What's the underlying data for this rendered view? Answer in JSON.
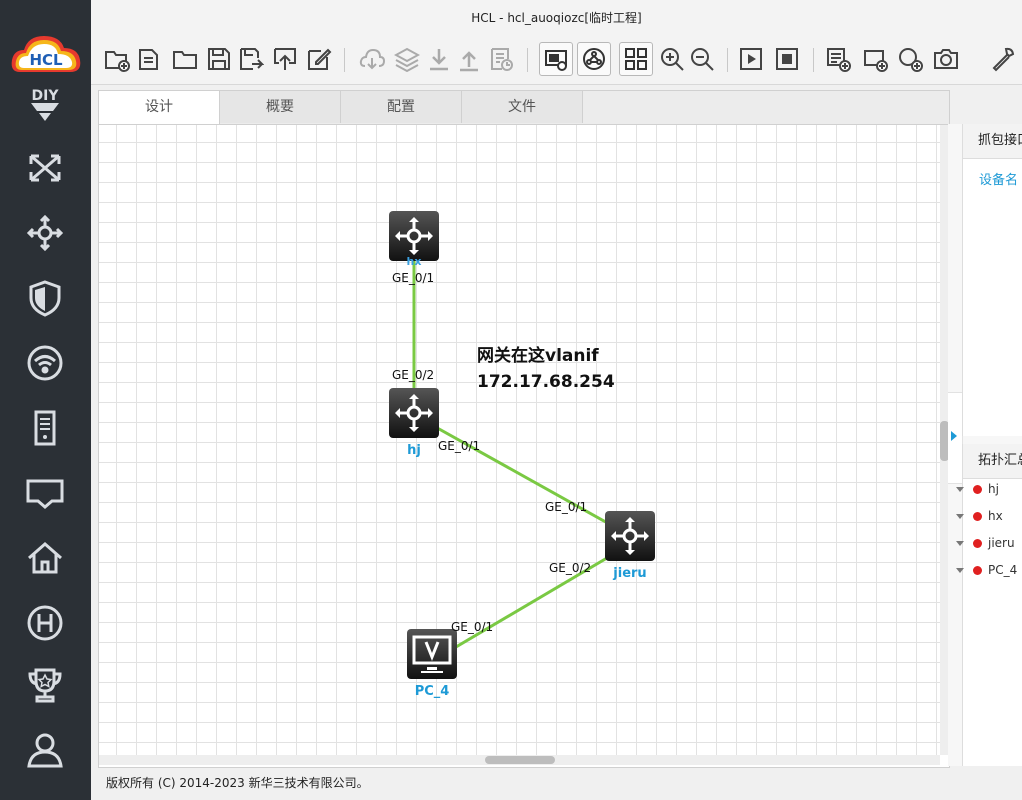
{
  "window": {
    "title": "HCL - hcl_auoqiozc[临时工程]"
  },
  "sidebar": {
    "logo_text": "HCL",
    "items": [
      {
        "name": "diy"
      },
      {
        "name": "switch"
      },
      {
        "name": "router"
      },
      {
        "name": "firewall"
      },
      {
        "name": "wireless"
      },
      {
        "name": "server"
      },
      {
        "name": "terminal"
      },
      {
        "name": "home"
      },
      {
        "name": "h3c"
      },
      {
        "name": "trophy"
      },
      {
        "name": "user"
      }
    ]
  },
  "toolbar": {
    "icons": [
      "new-project-icon",
      "open-project-icon",
      "folder-icon",
      "save-icon",
      "save-as-icon",
      "export-icon",
      "edit-icon",
      "cloud-icon",
      "layers-icon",
      "download-icon",
      "upload-icon",
      "log-icon",
      "screen-capture-icon",
      "topology-view-icon",
      "grid-view-icon",
      "zoom-in-icon",
      "zoom-out-icon",
      "start-icon",
      "stop-icon",
      "add-note-icon",
      "add-rect-icon",
      "add-ellipse-icon",
      "camera-icon",
      "settings-wrench-icon"
    ]
  },
  "tabs": [
    {
      "label": "设计",
      "active": true
    },
    {
      "label": "概要",
      "active": false
    },
    {
      "label": "配置",
      "active": false
    },
    {
      "label": "文件",
      "active": false
    }
  ],
  "topology": {
    "nodes": [
      {
        "id": "hx",
        "label": "hx",
        "type": "switch"
      },
      {
        "id": "hj",
        "label": "hj",
        "type": "switch"
      },
      {
        "id": "jieru",
        "label": "jieru",
        "type": "switch"
      },
      {
        "id": "pc4",
        "label": "PC_4",
        "type": "pc"
      }
    ],
    "ports": {
      "hx_down": "GE_0/1",
      "hj_up": "GE_0/2",
      "hj_right": "GE_0/1",
      "jieru_up": "GE_0/1",
      "jieru_left": "GE_0/2",
      "pc_up": "GE_0/1"
    },
    "note": {
      "line1": "网关在这vlanif",
      "line2": "172.17.68.254"
    },
    "link_color": "#7ac943"
  },
  "right_panel": {
    "capture_header": "抓包接口",
    "device_name_link": "设备名",
    "topo_header": "拓扑汇总",
    "topo_items": [
      "hj",
      "hx",
      "jieru",
      "PC_4"
    ]
  },
  "footer": {
    "copyright": "版权所有 (C) 2014-2023 新华三技术有限公司。"
  }
}
